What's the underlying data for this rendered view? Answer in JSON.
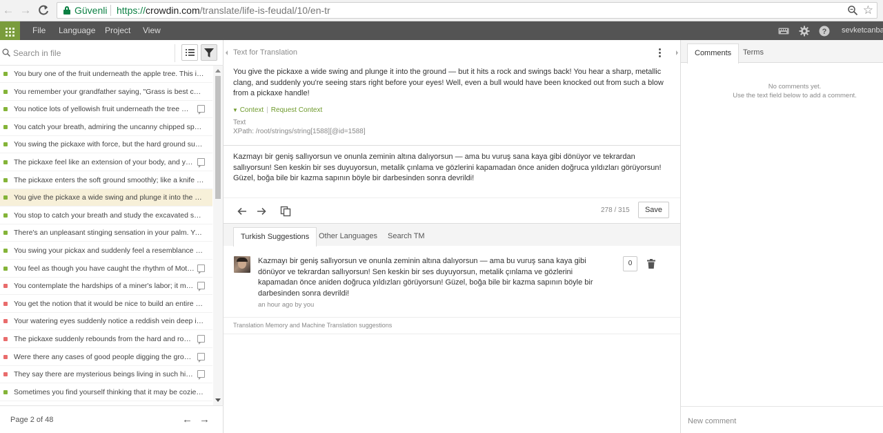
{
  "browser": {
    "secure_label": "Güvenli",
    "url_protocol": "https://",
    "url_host": "crowdin.com",
    "url_path": "/translate/life-is-feudal/10/en-tr"
  },
  "toolbar": {
    "menu": [
      "File",
      "Language",
      "Project",
      "View"
    ],
    "username": "sevketcanba"
  },
  "left_panel": {
    "search_placeholder": "Search in file",
    "pager_label": "Page 2 of 48",
    "strings": [
      {
        "text": "You bury one of the fruit underneath the apple tree. This is y...",
        "status": "translated",
        "comment": false
      },
      {
        "text": "You remember your grandfather saying, \"Grass is best cut wh...",
        "status": "translated",
        "comment": false
      },
      {
        "text": "You notice lots of yellowish fruit underneath the tree — s...",
        "status": "translated",
        "comment": true
      },
      {
        "text": "You catch your breath, admiring the uncanny chipped spot. ...",
        "status": "translated",
        "comment": false
      },
      {
        "text": "You swing the pickaxe with force, but the hard ground sudde...",
        "status": "translated",
        "comment": false
      },
      {
        "text": "The pickaxe feel like an extension of your body, and you r...",
        "status": "translated",
        "comment": true
      },
      {
        "text": "The pickaxe enters the soft ground smoothly; like a knife thro...",
        "status": "translated",
        "comment": false
      },
      {
        "text": "You give the pickaxe a wide swing and plunge it into the grou...",
        "status": "translated",
        "comment": false,
        "selected": true
      },
      {
        "text": "You stop to catch your breath and study the excavated soil. It...",
        "status": "translated",
        "comment": false
      },
      {
        "text": "There's an unpleasant stinging sensation in your palm. You e...",
        "status": "translated",
        "comment": false
      },
      {
        "text": "You swing your pickax and suddenly feel a resemblance to a ...",
        "status": "translated",
        "comment": false
      },
      {
        "text": "You feel as though you have caught the rhythm of Mother...",
        "status": "translated",
        "comment": true
      },
      {
        "text": "You contemplate the hardships of a miner's labor; it must...",
        "status": "untranslated",
        "comment": true
      },
      {
        "text": "You get the notion that it would be nice to build an entire city...",
        "status": "untranslated",
        "comment": false
      },
      {
        "text": "Your watering eyes suddenly notice a reddish vein deep in th...",
        "status": "untranslated",
        "comment": false
      },
      {
        "text": "The pickaxe suddenly rebounds from the hard and rocky ...",
        "status": "untranslated",
        "comment": true
      },
      {
        "text": "Were there any cases of good people digging the ground ...",
        "status": "untranslated",
        "comment": true
      },
      {
        "text": "They say there are mysterious beings living in such hills. T...",
        "status": "untranslated",
        "comment": true
      },
      {
        "text": "Sometimes you find yourself thinking that it may be cozier un...",
        "status": "translated",
        "comment": false
      }
    ]
  },
  "editor": {
    "source_header": "Text for Translation",
    "source_text": "You give the pickaxe a wide swing and plunge it into the ground — but it hits a rock and swings back! You hear a sharp, metallic clang, and suddenly you're seeing stars right before your eyes! Well, even a bull would have been knocked out from such a blow from a pickaxe handle!",
    "context_label": "Context",
    "request_context_label": "Request Context",
    "meta_type": "Text",
    "meta_xpath": "XPath: /root/strings/string[1588][@id=1588]",
    "translation_text": "Kazmayı bir geniş sallıyorsun ve onunla zeminin altına dalıyorsun — ama bu vuruş sana kaya gibi dönüyor ve tekrardan sallıyorsun! Sen keskin bir ses duyuyorsun, metalik çınlama ve gözlerini kapamadan önce aniden doğruca yıldızları görüyorsun! Güzel, boğa bile bir kazma sapının böyle bir darbesinden sonra devrildi!",
    "counter": "278 / 315",
    "save_label": "Save"
  },
  "suggestions": {
    "tabs": [
      "Turkish Suggestions",
      "Other Languages",
      "Search TM"
    ],
    "items": [
      {
        "text": "Kazmayı bir geniş sallıyorsun ve onunla zeminin altına dalıyorsun — ama bu vuruş sana kaya gibi dönüyor ve tekrardan sallıyorsun! Sen keskin bir ses duyuyorsun, metalik çınlama ve gözlerini kapamadan önce aniden doğruca yıldızları görüyorsun! Güzel, boğa bile bir kazma sapının böyle bir darbesinden sonra devrildi!",
        "meta": "an hour ago by you",
        "votes": "0"
      }
    ],
    "tm_label": "Translation Memory and Machine Translation suggestions"
  },
  "right_panel": {
    "tabs": [
      "Comments",
      "Terms"
    ],
    "no_comments_line1": "No comments yet.",
    "no_comments_line2": "Use the text field below to add a comment.",
    "new_comment_placeholder": "New comment"
  },
  "colors": {
    "translated": "#84b438",
    "untranslated": "#e96c6c",
    "toolbar_bg": "#545454",
    "apps_green": "#7a9c3c",
    "selected_row": "#f7f0d9",
    "link_green": "#6e9a2c"
  }
}
